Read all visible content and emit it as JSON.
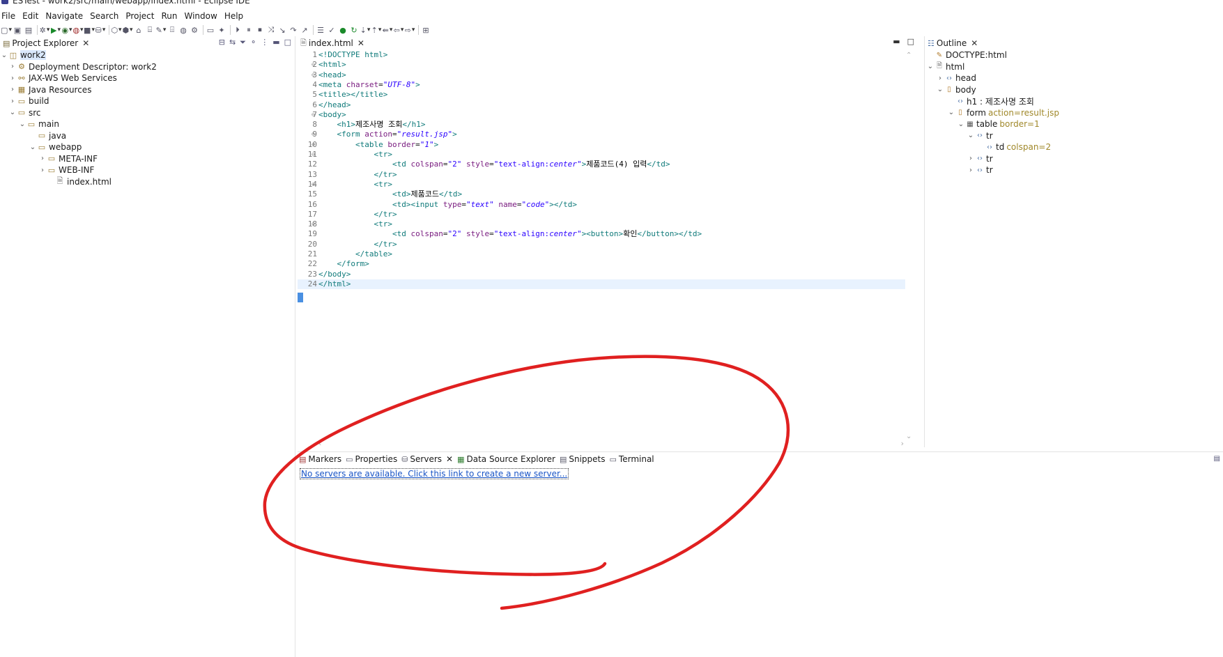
{
  "window": {
    "title": "ESTest - work2/src/main/webapp/index.html - Eclipse IDE"
  },
  "menu": [
    "File",
    "Edit",
    "Navigate",
    "Search",
    "Project",
    "Run",
    "Window",
    "Help"
  ],
  "project_explorer": {
    "tab_label": "Project Explorer",
    "items": [
      {
        "label": "work2",
        "icon": "project-icon"
      },
      {
        "label": "Deployment Descriptor: work2",
        "icon": "descriptor-icon"
      },
      {
        "label": "JAX-WS Web Services",
        "icon": "webservice-icon"
      },
      {
        "label": "Java Resources",
        "icon": "java-resources-icon"
      },
      {
        "label": "build",
        "icon": "folder-icon"
      },
      {
        "label": "src",
        "icon": "folder-icon"
      },
      {
        "label": "main",
        "icon": "folder-icon"
      },
      {
        "label": "java",
        "icon": "folder-icon"
      },
      {
        "label": "webapp",
        "icon": "folder-icon"
      },
      {
        "label": "META-INF",
        "icon": "folder-icon"
      },
      {
        "label": "WEB-INF",
        "icon": "folder-icon"
      },
      {
        "label": "index.html",
        "icon": "html-file-icon"
      }
    ]
  },
  "editor": {
    "tab_label": "index.html",
    "line_numbers": [
      "1",
      "2",
      "3",
      "4",
      "5",
      "6",
      "7",
      "8",
      "9",
      "10",
      "11",
      "12",
      "13",
      "14",
      "15",
      "16",
      "17",
      "18",
      "19",
      "20",
      "21",
      "22",
      "23",
      "24"
    ]
  },
  "outline": {
    "tab_label": "Outline",
    "items": [
      {
        "label": "DOCTYPE:html",
        "attr": ""
      },
      {
        "label": "html",
        "attr": ""
      },
      {
        "label": "head",
        "attr": ""
      },
      {
        "label": "body",
        "attr": ""
      },
      {
        "label": "h1 : 제조사명 조회",
        "attr": ""
      },
      {
        "label": "form",
        "attr": "action=result.jsp"
      },
      {
        "label": "table",
        "attr": "border=1"
      },
      {
        "label": "tr",
        "attr": ""
      },
      {
        "label": "td",
        "attr": "colspan=2"
      },
      {
        "label": "tr",
        "attr": ""
      },
      {
        "label": "tr",
        "attr": ""
      }
    ]
  },
  "bottom_panel": {
    "tabs": [
      "Markers",
      "Properties",
      "Servers",
      "Data Source Explorer",
      "Snippets",
      "Terminal"
    ],
    "servers_message": "No servers are available. Click this link to create a new server..."
  },
  "colors": {
    "annotation": "#e02020",
    "link": "#1a55c6",
    "selection": "#d9e8fb"
  }
}
